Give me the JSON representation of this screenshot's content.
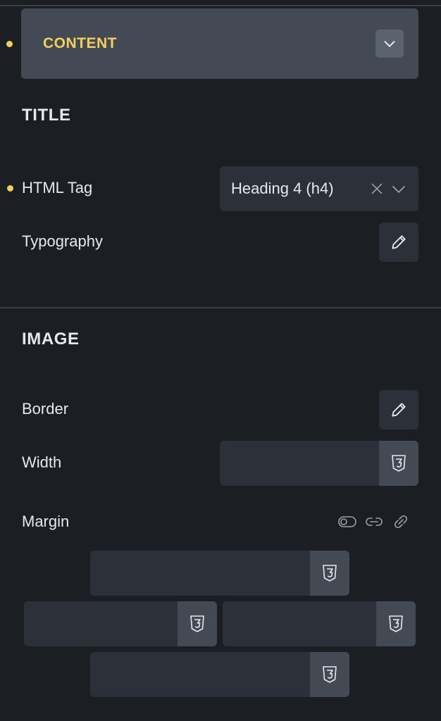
{
  "content_panel": {
    "label": "CONTENT"
  },
  "title_section": {
    "title": "TITLE",
    "html_tag": {
      "label": "HTML Tag",
      "value": "Heading 4 (h4)"
    },
    "typography": {
      "label": "Typography"
    }
  },
  "image_section": {
    "title": "IMAGE",
    "border": {
      "label": "Border"
    },
    "width": {
      "label": "Width",
      "value": ""
    },
    "margin": {
      "label": "Margin",
      "top": "",
      "right": "",
      "bottom": "",
      "left": ""
    }
  },
  "colors": {
    "accent": "#f4cf5b",
    "background": "#1b1e22",
    "field": "#2c3139"
  }
}
